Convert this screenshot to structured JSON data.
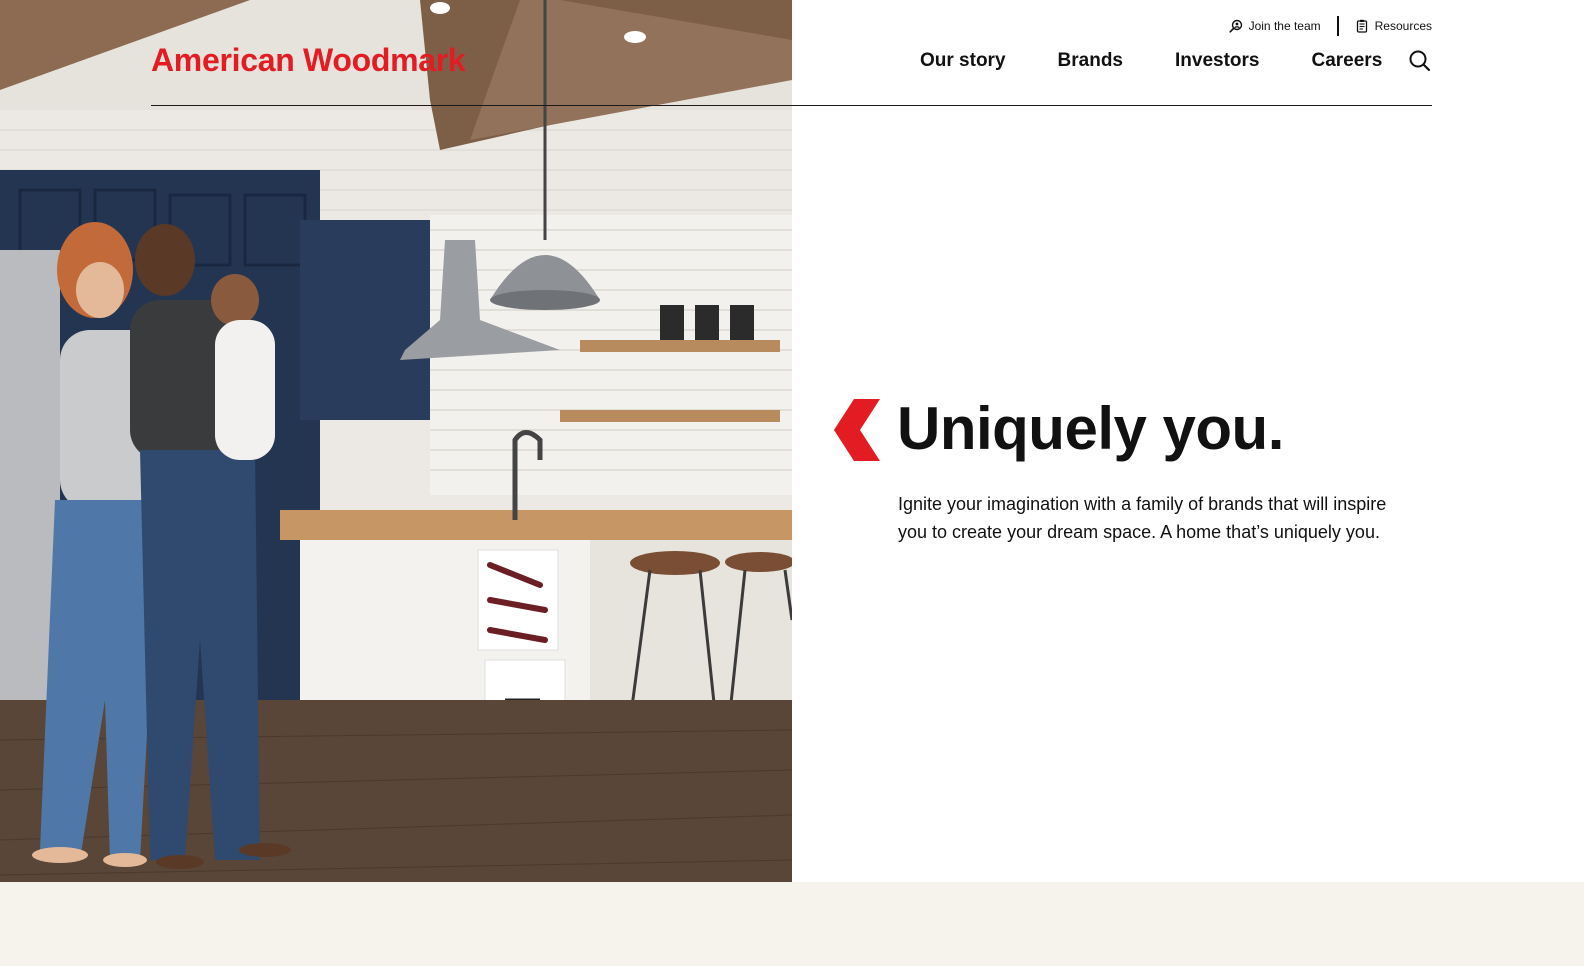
{
  "brand": {
    "logo_text": "American Woodmark",
    "accent_color": "#e31c23"
  },
  "utility_nav": {
    "join_label": "Join the team",
    "join_icon": "person-search-icon",
    "resources_label": "Resources",
    "resources_icon": "document-icon"
  },
  "main_nav": {
    "items": [
      {
        "label": "Our story"
      },
      {
        "label": "Brands"
      },
      {
        "label": "Investors"
      },
      {
        "label": "Careers"
      }
    ],
    "search_icon": "search-icon"
  },
  "hero": {
    "headline": "Uniquely you.",
    "body": "Ignite your imagination with a family of brands that will inspire you to create your dream space. A home that’s uniquely you.",
    "chevron_icon": "chevron-left-icon",
    "image_alt": "family-in-kitchen-photo"
  },
  "colors": {
    "bottom_band": "#f6f3ec",
    "text": "#111111"
  }
}
